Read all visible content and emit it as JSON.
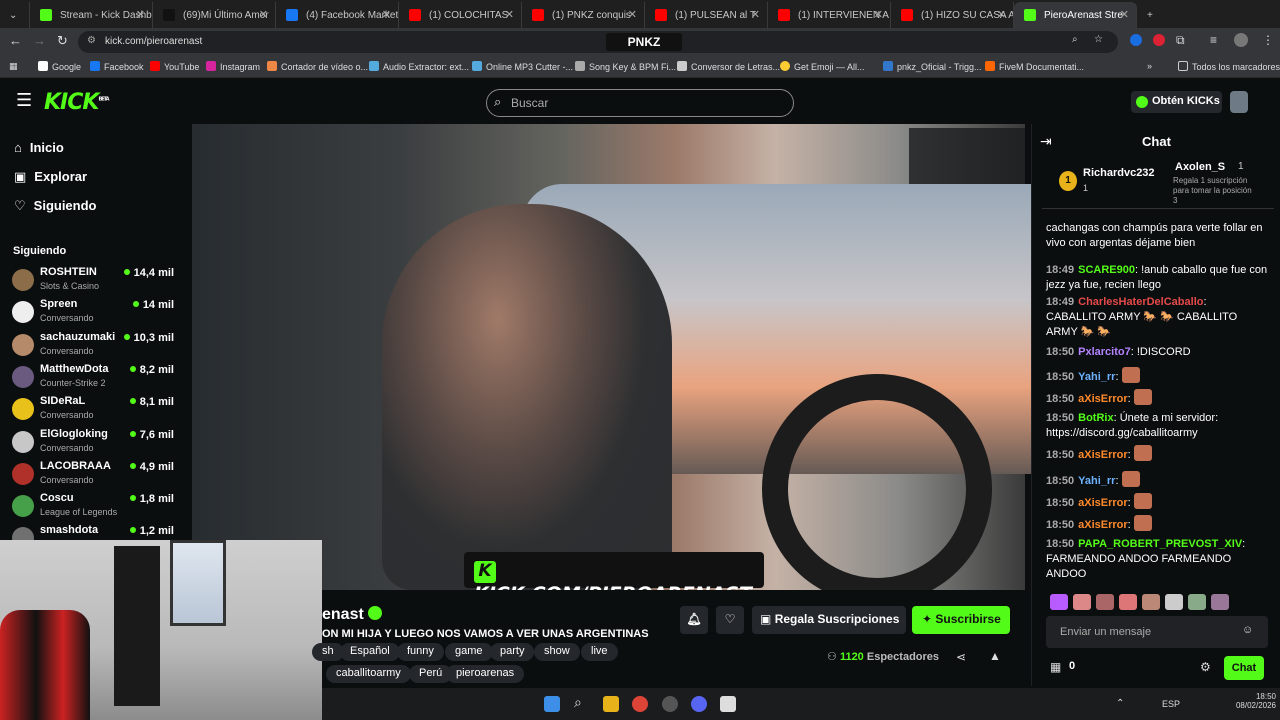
{
  "tabs": [
    {
      "label": "Stream - Kick Dashbo",
      "color": "#53fc18"
    },
    {
      "label": "(69)Mi Último Amor",
      "color": "#111111"
    },
    {
      "label": "(4) Facebook Marketp",
      "color": "#1877f2"
    },
    {
      "label": "(1) COLOCHITAS",
      "color": "#ff0000"
    },
    {
      "label": "(1) PNKZ conquis",
      "color": "#ff0000"
    },
    {
      "label": "(1) PULSEAN al T",
      "color": "#ff0000"
    },
    {
      "label": "(1) INTERVIENEN A K",
      "color": "#ff0000"
    },
    {
      "label": "(1) HIZO SU CASA AL",
      "color": "#ff0000"
    },
    {
      "label": "PieroArenast Stre",
      "color": "#53fc18"
    }
  ],
  "browser": {
    "url": "kick.com/pieroarenast",
    "center_logo": "PNKZ",
    "all_bookmarks": "Todos los marcadores"
  },
  "bookmarks": [
    "Google",
    "Facebook",
    "YouTube",
    "Instagram",
    "Cortador de vídeo o...",
    "Audio Extractor: ext...",
    "Online MP3 Cutter -...",
    "Song Key & BPM Fi...",
    "Conversor de Letras...",
    "Get Emoji — All...",
    "pnkz_Oficial - Trigg...",
    "FiveM Documentati..."
  ],
  "kick": {
    "logo": "KICK",
    "logo_badge": "BETA",
    "search_placeholder": "Buscar",
    "kicks_button": "Obtén KICKs"
  },
  "nav": [
    {
      "label": "Inicio",
      "icon": "home-icon"
    },
    {
      "label": "Explorar",
      "icon": "compass-icon"
    },
    {
      "label": "Siguiendo",
      "icon": "heart-icon"
    }
  ],
  "following_header": "Siguiendo",
  "following": [
    {
      "name": "ROSHTEIN",
      "category": "Slots & Casino",
      "viewers": "14,4 mil",
      "color": "#8b6d4a"
    },
    {
      "name": "Spreen",
      "category": "Conversando",
      "viewers": "14 mil",
      "color": "#eeeeee"
    },
    {
      "name": "sachauzumaki",
      "category": "Conversando",
      "viewers": "10,3 mil",
      "color": "#b58a6a"
    },
    {
      "name": "MatthewDota",
      "category": "Counter-Strike 2",
      "viewers": "8,2 mil",
      "color": "#6a5a80"
    },
    {
      "name": "SIDeRaL",
      "category": "Conversando",
      "viewers": "8,1 mil",
      "color": "#e8c21a"
    },
    {
      "name": "ElGlogloking",
      "category": "Conversando",
      "viewers": "7,6 mil",
      "color": "#c7c7c7"
    },
    {
      "name": "LACOBRAAA",
      "category": "Conversando",
      "viewers": "4,9 mil",
      "color": "#b0302a"
    },
    {
      "name": "Coscu",
      "category": "League of Legends",
      "viewers": "1,8 mil",
      "color": "#46a04a"
    },
    {
      "name": "smashdota",
      "category": "",
      "viewers": "1,2 mil",
      "color": "#707070"
    }
  ],
  "video": {
    "watermark": "KICK.COM/PIEROARENAST"
  },
  "stream": {
    "name": "enast",
    "title": "ON MI HIJA Y LUEGO NOS VAMOS A VER UNAS ARGENTINAS",
    "tags_row1": [
      "sh",
      "Español",
      "funny",
      "game",
      "party",
      "show",
      "live"
    ],
    "tags_row2": [
      "caballitoarmy",
      "Perú",
      "pieroarenas"
    ],
    "gift_button": "Regala Suscripciones",
    "subscribe_button": "Suscribirse",
    "viewers": "1120",
    "viewers_label": "Espectadores"
  },
  "chat": {
    "title": "Chat",
    "pinned": {
      "first_user": "Richardvc232",
      "first_count": "1",
      "second_user": "Axolen_S",
      "second_count": "1",
      "second_note": "Regala 1 suscripción para tomar la posición 3"
    },
    "messages": [
      {
        "time": "",
        "user": "",
        "user_color": "#ffffff",
        "text": "cachangas con champús para verte follar en vivo con argentas déjame bien"
      },
      {
        "time": "18:49",
        "user": "SCARE900",
        "user_color": "#53fc18",
        "text": ": !anub caballo que fue con jezz ya fue, recien llego"
      },
      {
        "time": "18:49",
        "user": "CharlesHaterDelCaballo",
        "user_color": "#e64a4a",
        "text": ": CABALLITO ARMY 🐎 🐎 CABALLITO ARMY 🐎 🐎"
      },
      {
        "time": "18:50",
        "user": "Pxlarcito7",
        "user_color": "#b483ff",
        "text": ": !DISCORD"
      },
      {
        "time": "18:50",
        "user": "Yahi_rr",
        "user_color": "#6bb3ff",
        "text": ":"
      },
      {
        "time": "18:50",
        "user": "aXisError",
        "user_color": "#ff8a2b",
        "text": ":"
      },
      {
        "time": "18:50",
        "user": "BotRix",
        "user_color": "#53fc18",
        "text": ": Únete a mi servidor: https://discord.gg/caballitoarmy"
      },
      {
        "time": "18:50",
        "user": "aXisError",
        "user_color": "#ff8a2b",
        "text": ":"
      },
      {
        "time": "18:50",
        "user": "Yahi_rr",
        "user_color": "#6bb3ff",
        "text": ":"
      },
      {
        "time": "18:50",
        "user": "aXisError",
        "user_color": "#ff8a2b",
        "text": ":"
      },
      {
        "time": "18:50",
        "user": "aXisError",
        "user_color": "#ff8a2b",
        "text": ":"
      },
      {
        "time": "18:50",
        "user": "PAPA_ROBERT_PREVOST_XIV",
        "user_color": "#53fc18",
        "text": ": FARMEANDO ANDOO FARMEANDO ANDOO"
      }
    ],
    "input_placeholder": "Enviar un mensaje",
    "kicks_count": "0",
    "send_button": "Chat"
  },
  "taskbar": {
    "lang": "ESP",
    "time": "18:50",
    "date": "08/02/2026"
  }
}
